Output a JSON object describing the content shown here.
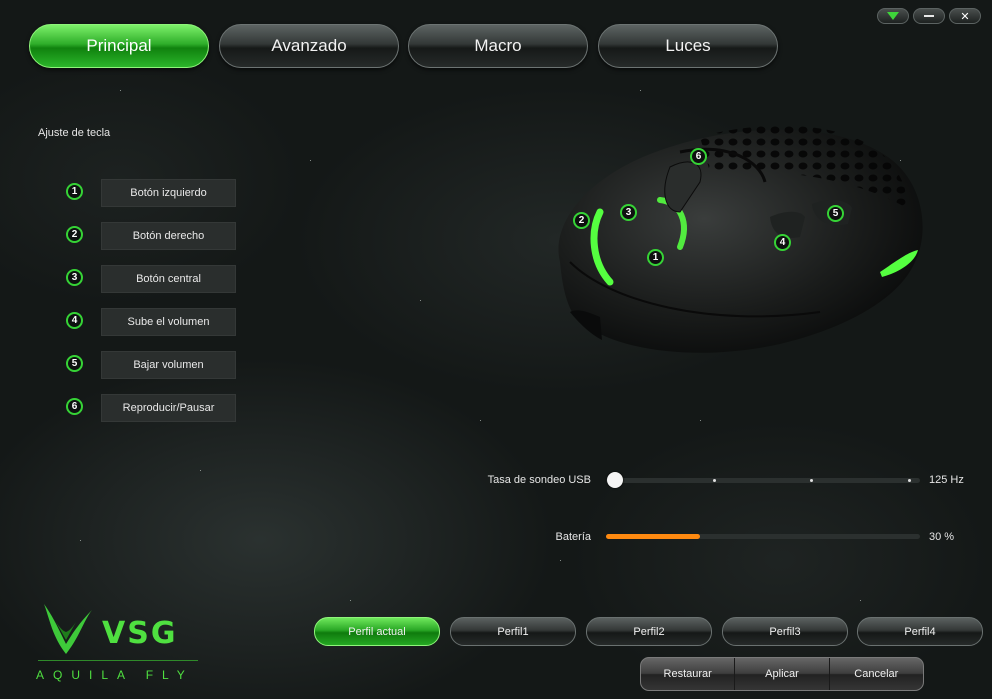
{
  "window_controls": {
    "menu": "triangle-down",
    "minimize": "minimize",
    "close": "✕"
  },
  "tabs": [
    {
      "label": "Principal",
      "active": true
    },
    {
      "label": "Avanzado",
      "active": false
    },
    {
      "label": "Macro",
      "active": false
    },
    {
      "label": "Luces",
      "active": false
    }
  ],
  "key_section": {
    "title": "Ajuste de tecla",
    "keys": [
      {
        "num": "1",
        "label": "Botón izquierdo"
      },
      {
        "num": "2",
        "label": "Botón derecho"
      },
      {
        "num": "3",
        "label": "Botón central"
      },
      {
        "num": "4",
        "label": "Sube el volumen"
      },
      {
        "num": "5",
        "label": "Bajar volumen"
      },
      {
        "num": "6",
        "label": "Reproducir/Pausar"
      }
    ]
  },
  "mouse_markers": [
    "1",
    "2",
    "3",
    "4",
    "5",
    "6"
  ],
  "polling": {
    "label": "Tasa de sondeo USB",
    "value": "125 Hz",
    "level": 0
  },
  "battery": {
    "label": "Batería",
    "value": "30 %",
    "level": 30
  },
  "logo": {
    "brand": "VSG",
    "product": "AQUILA FLY"
  },
  "profiles": [
    {
      "label": "Perfil actual",
      "active": true
    },
    {
      "label": "Perfil1",
      "active": false
    },
    {
      "label": "Perfil2",
      "active": false
    },
    {
      "label": "Perfil3",
      "active": false
    },
    {
      "label": "Perfil4",
      "active": false
    }
  ],
  "actions": {
    "restore": "Restaurar",
    "apply": "Aplicar",
    "cancel": "Cancelar"
  },
  "colors": {
    "accent_green": "#36d336",
    "battery_orange": "#ff8a10"
  }
}
